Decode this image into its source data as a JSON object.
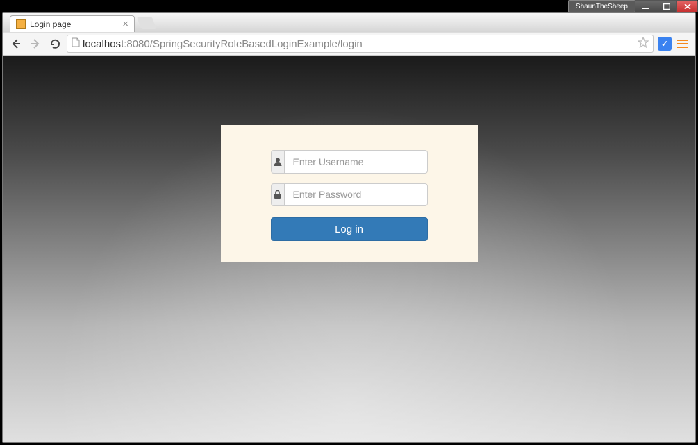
{
  "system": {
    "username": "ShaunTheSheep"
  },
  "browser": {
    "tab_title": "Login page",
    "url_host": "localhost",
    "url_port_path": ":8080/SpringSecurityRoleBasedLoginExample/login"
  },
  "login": {
    "username_placeholder": "Enter Username",
    "password_placeholder": "Enter Password",
    "button_label": "Log in"
  }
}
